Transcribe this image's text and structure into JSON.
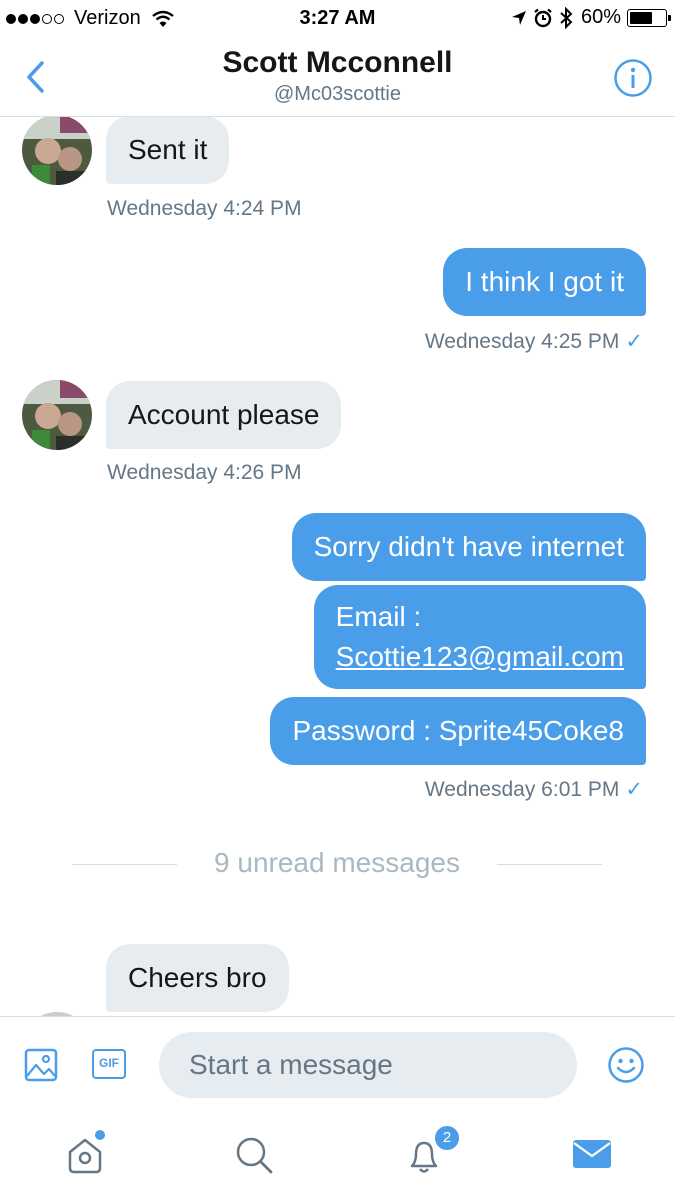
{
  "status_bar": {
    "carrier": "Verizon",
    "time": "3:27 AM",
    "battery": "60%",
    "signal_bars_filled": 3,
    "signal_bars_total": 5,
    "battery_level": 0.6
  },
  "header": {
    "title": "Scott Mcconnell",
    "handle": "@Mc03scottie"
  },
  "messages": [
    {
      "direction": "in",
      "text": "Sent it",
      "timestamp": "Wednesday 4:24 PM"
    },
    {
      "direction": "out",
      "text": "I think I got it",
      "timestamp": "Wednesday 4:25 PM"
    },
    {
      "direction": "in",
      "text": "Account please",
      "timestamp": "Wednesday 4:26 PM"
    },
    {
      "direction": "out",
      "text": "Sorry didn't have internet"
    },
    {
      "direction": "out",
      "text_label": "Email :",
      "text_link": "Scottie123@gmail.com"
    },
    {
      "direction": "out",
      "text": "Password : Sprite45Coke8",
      "timestamp": "Wednesday 6:01 PM"
    },
    {
      "direction": "in",
      "text": "Cheers bro"
    }
  ],
  "divider": {
    "label": "9 unread messages"
  },
  "composer": {
    "placeholder": "Start a message",
    "gif_label": "GIF"
  },
  "tabbar": {
    "notifications_badge": "2",
    "active_tab": "messages"
  },
  "colors": {
    "accent": "#4a9ee9",
    "incoming_bubble": "#e6ecf0",
    "secondary_text": "#657786",
    "divider_text": "#aab8c2"
  },
  "icons": [
    "back-chevron-icon",
    "info-icon",
    "wifi-icon",
    "location-arrow-icon",
    "alarm-icon",
    "bluetooth-icon",
    "battery-icon",
    "image-icon",
    "gif-icon",
    "emoji-icon",
    "home-icon",
    "search-icon",
    "bell-icon",
    "mail-icon",
    "checkmark-icon"
  ]
}
